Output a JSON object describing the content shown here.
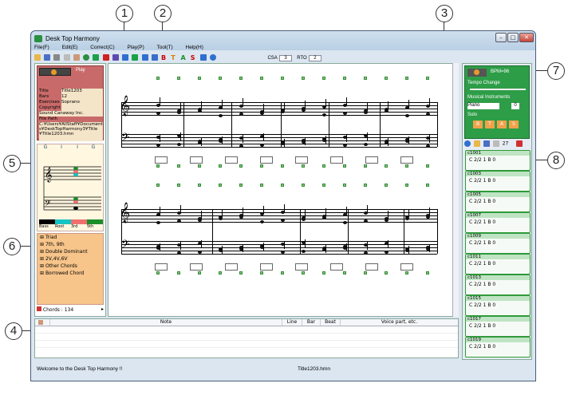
{
  "app": {
    "title": "Desk Top Harmony"
  },
  "menu": [
    "File(F)",
    "Edit(E)",
    "Correct(C)",
    "Play(P)",
    "Tool(T)",
    "Help(H)"
  ],
  "toolbar": {
    "csa_label": "CSA",
    "csa_value": "3",
    "rto_label": "RTO",
    "rto_value": "2"
  },
  "left_info": {
    "play_label": "Play",
    "rows": [
      {
        "k": "Title",
        "v": "Title1203"
      },
      {
        "k": "Bars",
        "v": "12"
      },
      {
        "k": "Exercises",
        "v": "Soprano"
      },
      {
        "k": "Copyright",
        "v": ""
      },
      {
        "k": "Sound Canaway Inc.",
        "v": ""
      }
    ],
    "file_path_label": "File Path",
    "file_path": "C:¥Users¥AllStaff¥Documents¥DeskTopHarmony3¥Title¥Title1203.hmn"
  },
  "chord_tabs": [
    "G",
    "I",
    "I",
    "G"
  ],
  "legend": [
    "Bass",
    "Root",
    "3rd",
    "5th"
  ],
  "legend_colors": [
    "#000000",
    "#15c4c4",
    "#f07070",
    "#1a8f2a"
  ],
  "chord_tree": [
    "Triad",
    "7th, 9th",
    "Double Dominant",
    "2V,4V,6V",
    "Other Chords",
    "Borrowed Chord"
  ],
  "chords_footer": "Chords : 134",
  "right_panel": {
    "bpm": "BPM=96",
    "tempo_label": "Tempo Change",
    "instruments_label": "Musical Instruments",
    "instrument": "Piano",
    "instrument_value": "0",
    "solo_label": "Solo",
    "solo_buttons": [
      "B",
      "T",
      "A",
      "S"
    ],
    "count": "27",
    "clips": [
      {
        "id": "c1001",
        "line": "C    2/2  1  B  0"
      },
      {
        "id": "c1003",
        "line": "C    2/2  1  B  0"
      },
      {
        "id": "c1005",
        "line": "C    2/2  1  B  0"
      },
      {
        "id": "c1007",
        "line": "C    2/2  1  B  0"
      },
      {
        "id": "c1009",
        "line": "C    2/2  1  B  0"
      },
      {
        "id": "c1011",
        "line": "C    2/2  1  B  0"
      },
      {
        "id": "c1013",
        "line": "C    2/2  1  B  0"
      },
      {
        "id": "c1015",
        "line": "C    2/2  1  B  0"
      },
      {
        "id": "c1017",
        "line": "C    2/2  1  B  0"
      },
      {
        "id": "c1019",
        "line": "C    2/2  1  B  0"
      }
    ]
  },
  "bottom_table": {
    "headers": [
      "Note",
      "Line",
      "Bar",
      "Beat",
      "Voice part, etc."
    ]
  },
  "status": {
    "message": "Welcome to the Desk Top Harmony !!",
    "file": "Title1203.hmn"
  },
  "callouts": [
    "1",
    "2",
    "3",
    "4",
    "5",
    "6",
    "7",
    "8"
  ]
}
